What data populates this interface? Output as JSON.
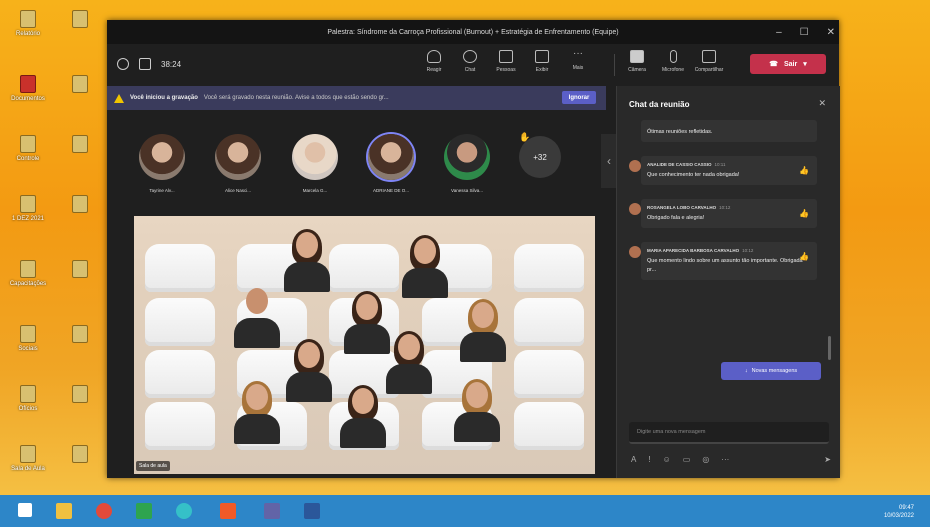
{
  "window_title": "Palestra: Síndrome da Carroça Profissional (Burnout) + Estratégia de Enfrentamento (Equipe)",
  "toolbar": {
    "timer": "38:24",
    "tools": [
      {
        "label": "Reagir",
        "icon": "hand-icon"
      },
      {
        "label": "Chat",
        "icon": "chat-icon"
      },
      {
        "label": "Pessoas",
        "icon": "people-icon"
      },
      {
        "label": "Exibir",
        "icon": "view-icon"
      },
      {
        "label": "Mais",
        "icon": "more-icon"
      }
    ],
    "media": [
      {
        "label": "Câmera",
        "icon": "camera-icon"
      },
      {
        "label": "Microfone",
        "icon": "mic-icon"
      },
      {
        "label": "Compartilhar",
        "icon": "share-icon"
      }
    ],
    "leave_label": "Sair"
  },
  "banner": {
    "title": "Você iniciou a gravação",
    "message": "Você será gravado nesta reunião. Avise a todos que estão sendo gr...",
    "dismiss": "Ignorar"
  },
  "participants": [
    {
      "name": "Tayrine Alv..."
    },
    {
      "name": "Alice Nasci..."
    },
    {
      "name": "Marcela G..."
    },
    {
      "name": "ADRIANE DE O..."
    },
    {
      "name": "Vanessa Silva..."
    }
  ],
  "more_participants": "+32",
  "video_label": "Sala de aula",
  "chat": {
    "title": "Chat da reunião",
    "messages": [
      {
        "author": "",
        "time": "",
        "text": "Ótimas reuniões refletidas."
      },
      {
        "author": "ANALIDE DE CASSIO CASSIO",
        "time": "10:11",
        "text": "Que conhecimento ter nada obrigada!"
      },
      {
        "author": "ROSANGELA LOBO CARVALHO",
        "time": "10:12",
        "text": "Obrigado fala e alegria!"
      },
      {
        "author": "MARIA APARECIDA BARBOSA CARVALHO",
        "time": "10:12",
        "text": "Que momento lindo sobre um assunto tão importante. Obrigada pr..."
      }
    ],
    "new_messages": "Novas mensagens",
    "input_placeholder": "Digite uma nova mensagem"
  },
  "taskbar": {
    "time": "09:47",
    "date": "10/03/2022"
  },
  "desktop_icons": [
    "Relatório",
    "Documentos",
    "Controle",
    "1 DEZ 2021",
    "Capacitações",
    "Sociais",
    "Ofícios",
    "Sala de Aula"
  ]
}
